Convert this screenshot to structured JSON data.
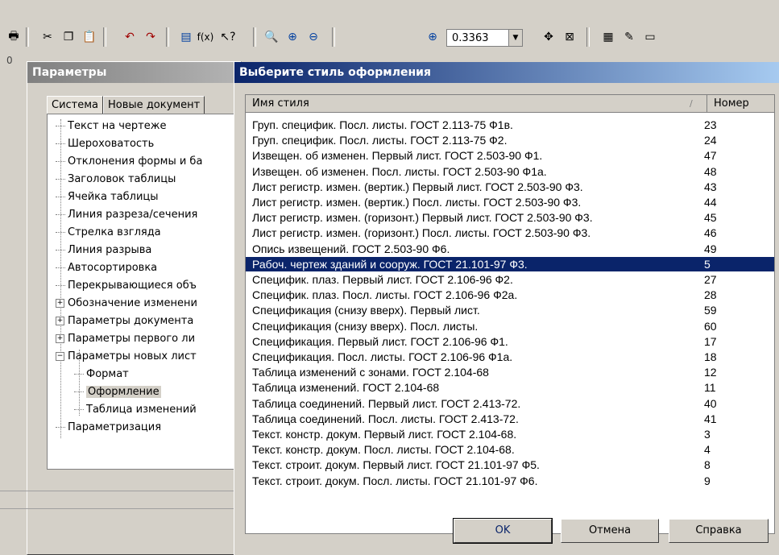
{
  "toolbar": {
    "zoom_value": "0.3363",
    "left_number": "0",
    "icons": [
      "print-preview-icon",
      "cut-icon",
      "copy-icon",
      "paste-icon",
      "undo-icon",
      "redo-icon",
      "manager-icon",
      "formula-icon",
      "context-help-icon",
      "zoom-window-icon",
      "zoom-in-icon",
      "zoom-out-icon",
      "zoom-scale-icon",
      "pan-icon",
      "show-all-icon",
      "properties-icon",
      "wrench-icon",
      "view-icon"
    ]
  },
  "params_window": {
    "title": "Параметры",
    "tabs": [
      "Система",
      "Новые документ"
    ],
    "tree": [
      {
        "label": "Текст на чертеже",
        "level": 0,
        "expander": ""
      },
      {
        "label": "Шероховатость",
        "level": 0,
        "expander": ""
      },
      {
        "label": "Отклонения формы и ба",
        "level": 0,
        "expander": ""
      },
      {
        "label": "Заголовок таблицы",
        "level": 0,
        "expander": ""
      },
      {
        "label": "Ячейка таблицы",
        "level": 0,
        "expander": ""
      },
      {
        "label": "Линия разреза/сечения",
        "level": 0,
        "expander": ""
      },
      {
        "label": "Стрелка взгляда",
        "level": 0,
        "expander": ""
      },
      {
        "label": "Линия разрыва",
        "level": 0,
        "expander": ""
      },
      {
        "label": "Автосортировка",
        "level": 0,
        "expander": ""
      },
      {
        "label": "Перекрывающиеся объ",
        "level": 0,
        "expander": ""
      },
      {
        "label": "Обозначение изменени",
        "level": 0,
        "expander": "+"
      },
      {
        "label": "Параметры документа",
        "level": 0,
        "expander": "+"
      },
      {
        "label": "Параметры первого ли",
        "level": 0,
        "expander": "+"
      },
      {
        "label": "Параметры новых лист",
        "level": 0,
        "expander": "−"
      },
      {
        "label": "Формат",
        "level": 1,
        "expander": ""
      },
      {
        "label": "Оформление",
        "level": 1,
        "expander": "",
        "selected": true
      },
      {
        "label": "Таблица изменений",
        "level": 1,
        "expander": ""
      },
      {
        "label": "Параметризация",
        "level": 0,
        "expander": ""
      }
    ]
  },
  "dialog": {
    "title": "Выберите стиль оформления",
    "columns": {
      "name": "Имя стиля",
      "number": "Номер"
    },
    "rows": [
      {
        "name": "Груп. специфик. Посл. листы. ГОСТ 2.113-75 Ф1в.",
        "number": "23"
      },
      {
        "name": "Груп. специфик. Посл. листы. ГОСТ 2.113-75 Ф2.",
        "number": "24"
      },
      {
        "name": "Извещен. об изменен. Первый лист. ГОСТ 2.503-90 Ф1.",
        "number": "47"
      },
      {
        "name": "Извещен. об изменен. Посл. листы. ГОСТ 2.503-90 Ф1а.",
        "number": "48"
      },
      {
        "name": "Лист регистр. измен. (вертик.) Первый лист. ГОСТ 2.503-90 Ф3.",
        "number": "43"
      },
      {
        "name": "Лист регистр. измен. (вертик.) Посл. листы. ГОСТ 2.503-90 Ф3.",
        "number": "44"
      },
      {
        "name": "Лист регистр. измен. (горизонт.) Первый лист. ГОСТ 2.503-90 Ф3.",
        "number": "45"
      },
      {
        "name": "Лист регистр. измен. (горизонт.) Посл. листы. ГОСТ 2.503-90 Ф3.",
        "number": "46"
      },
      {
        "name": "Опись извещений. ГОСТ 2.503-90 Ф6.",
        "number": "49"
      },
      {
        "name": "Рабоч. чертеж зданий и сооруж. ГОСТ 21.101-97 Ф3.",
        "number": "5",
        "selected": true
      },
      {
        "name": "Специфик. плаз. Первый лист. ГОСТ 2.106-96 Ф2.",
        "number": "27"
      },
      {
        "name": "Специфик. плаз. Посл. листы. ГОСТ 2.106-96 Ф2а.",
        "number": "28"
      },
      {
        "name": "Спецификация (снизу вверх). Первый лист.",
        "number": "59"
      },
      {
        "name": "Спецификация (снизу вверх). Посл. листы.",
        "number": "60"
      },
      {
        "name": "Спецификация. Первый лист. ГОСТ 2.106-96 Ф1.",
        "number": "17"
      },
      {
        "name": "Спецификация. Посл. листы. ГОСТ 2.106-96 Ф1а.",
        "number": "18"
      },
      {
        "name": "Таблица изменений с зонами. ГОСТ 2.104-68",
        "number": "12"
      },
      {
        "name": "Таблица изменений. ГОСТ 2.104-68",
        "number": "11"
      },
      {
        "name": "Таблица соединений. Первый лист. ГОСТ 2.413-72.",
        "number": "40"
      },
      {
        "name": "Таблица соединений. Посл. листы. ГОСТ 2.413-72.",
        "number": "41"
      },
      {
        "name": "Текст. констр. докум. Первый лист. ГОСТ 2.104-68.",
        "number": "3"
      },
      {
        "name": "Текст. констр. докум. Посл. листы. ГОСТ 2.104-68.",
        "number": "4"
      },
      {
        "name": "Текст. строит. докум. Первый лист. ГОСТ 21.101-97 Ф5.",
        "number": "8"
      },
      {
        "name": "Текст. строит. докум. Посл. листы. ГОСТ 21.101-97 Ф6.",
        "number": "9"
      }
    ],
    "buttons": {
      "ok": "OK",
      "cancel": "Отмена",
      "help": "Справка"
    }
  }
}
